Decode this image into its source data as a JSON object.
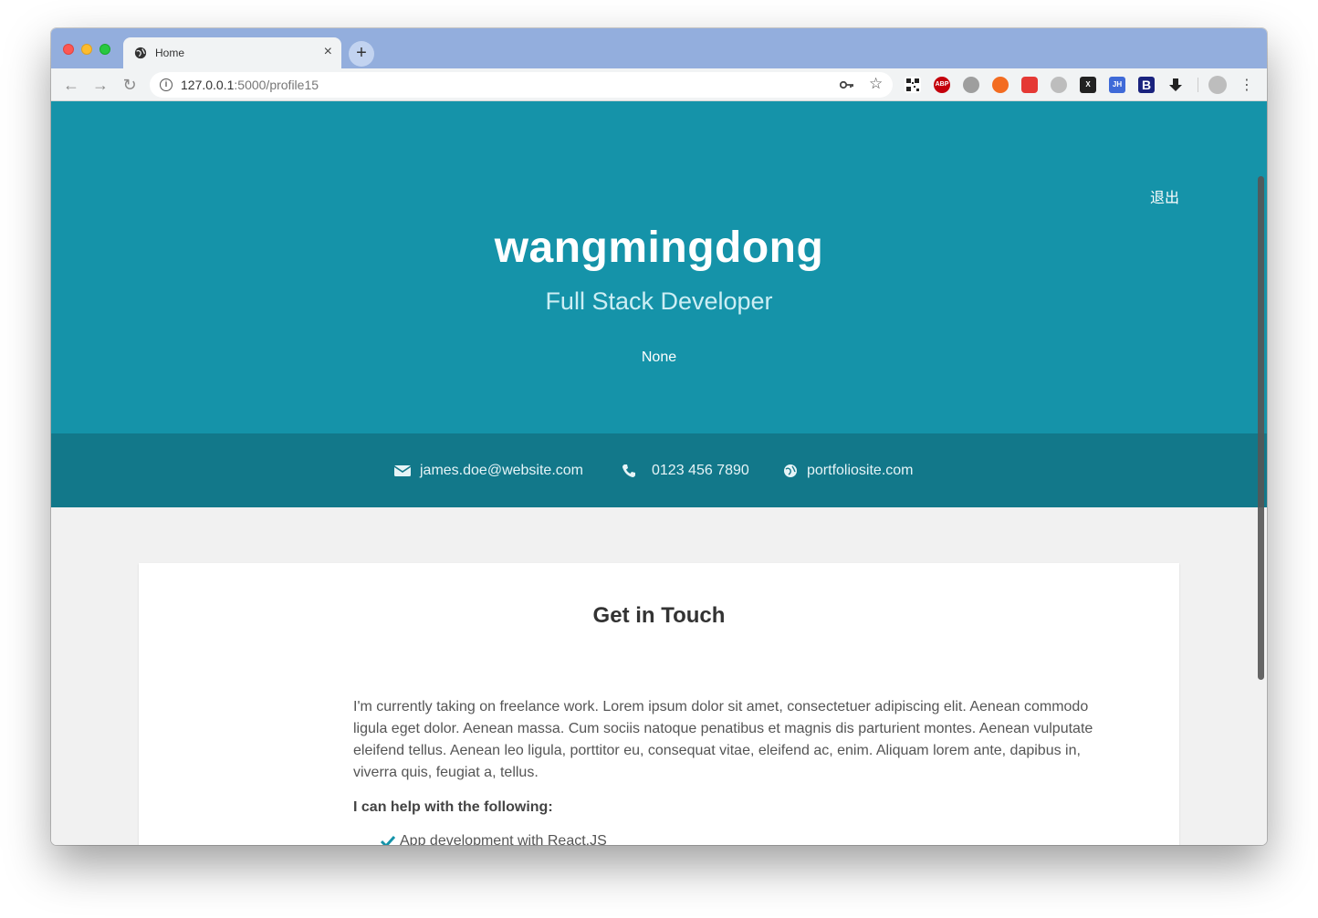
{
  "browser": {
    "tab_title": "Home",
    "tab_close": "×",
    "new_tab": "+",
    "url_host": "127.0.0.1",
    "url_path": ":5000/profile15",
    "extensions": [
      "qr-code-icon",
      "adblock-plus-icon",
      "globe-ext-icon",
      "ext-orange-icon",
      "ext-translate-icon",
      "ext-gray-icon",
      "ext-x-icon",
      "ext-jh-icon",
      "ext-b-icon",
      "download-icon"
    ],
    "ext_labels": {
      "abp": "ABP",
      "x": "X",
      "jh": "JH",
      "b": "B"
    }
  },
  "header": {
    "logout": "退出",
    "name": "wangmingdong",
    "title": "Full Stack Developer",
    "bio": "None"
  },
  "contact": {
    "email": "james.doe@website.com",
    "phone": "0123 456 7890",
    "website": "portfoliosite.com"
  },
  "card": {
    "title": "Get in Touch",
    "text": "I'm currently taking on freelance work. Lorem ipsum dolor sit amet, consectetuer adipiscing elit. Aenean commodo ligula eget dolor. Aenean massa. Cum sociis natoque penatibus et magnis dis parturient montes. Aenean vulputate eleifend tellus. Aenean leo ligula, porttitor eu, consequat vitae, eleifend ac, enim. Aliquam lorem ante, dapibus in, viverra quis, feugiat a, tellus.",
    "lead": "I can help with the following:",
    "items": [
      "App development with React.JS"
    ]
  },
  "colors": {
    "hero": "#1593a9",
    "contact_bar": "#12788a",
    "tabstrip": "#93aedd"
  }
}
